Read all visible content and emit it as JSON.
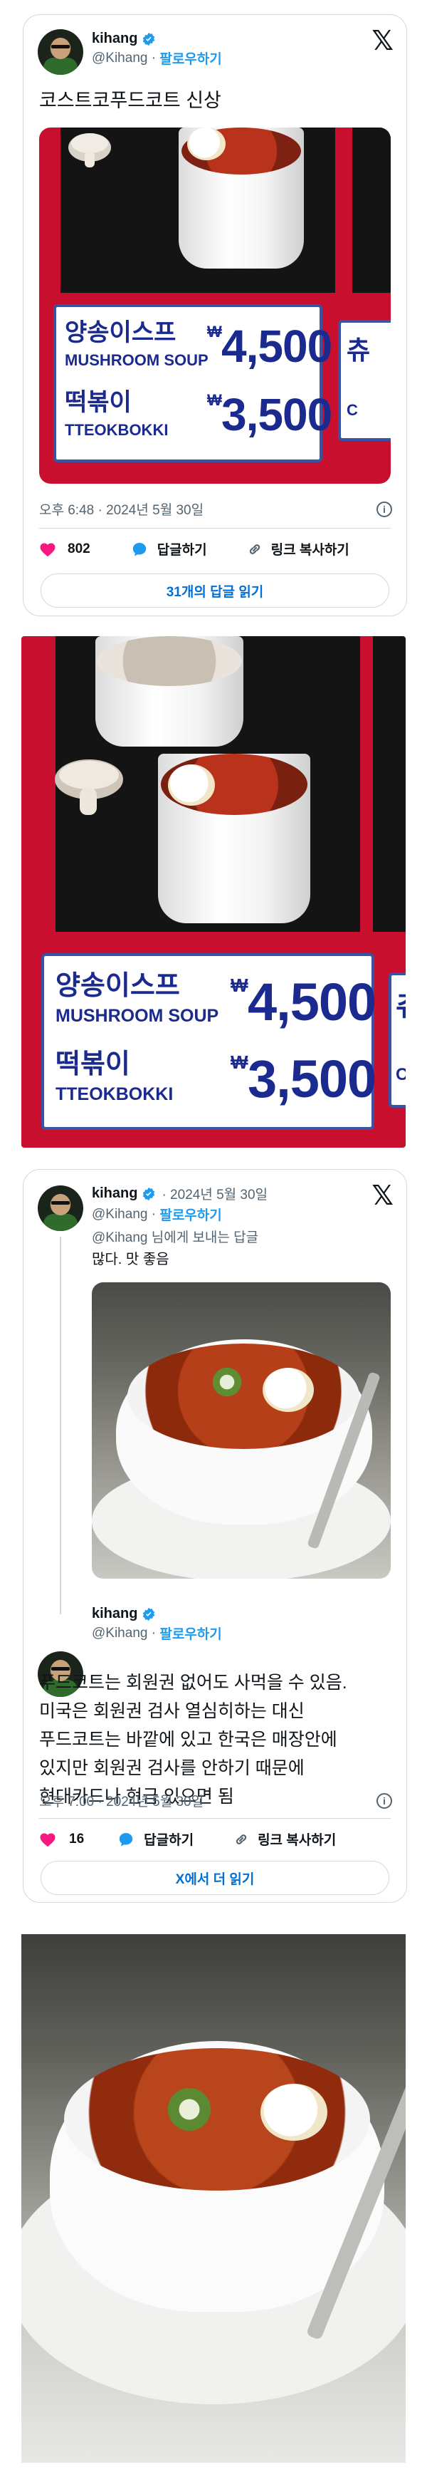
{
  "tweet1": {
    "display_name": "kihang",
    "handle": "@Kihang",
    "follow_label": "팔로우하기",
    "x_logo": "𝕏",
    "text": "코스트코푸드코트 신상",
    "timestamp": "오후 6:48 · 2024년 5월 30일",
    "info": "i",
    "likes": "802",
    "reply_label": "답글하기",
    "copy_link_label": "링크 복사하기",
    "read_replies": "31개의 답글 읽기"
  },
  "menu_board": {
    "item1_ko": "양송이스프",
    "item1_en": "MUSHROOM SOUP",
    "item1_price": "4,500",
    "item2_ko": "떡볶이",
    "item2_en": "TTEOKBOKKI",
    "item2_price": "3,500",
    "currency": "₩",
    "partial_ko": "츄",
    "partial_en": "C"
  },
  "tweet2": {
    "display_name": "kihang",
    "date_inline": "· 2024년 5월 30일",
    "handle": "@Kihang",
    "follow_label": "팔로우하기",
    "x_logo": "𝕏",
    "reply_context": "@Kihang 님에게 보내는 답글",
    "text": "많다. 맛 좋음"
  },
  "tweet3": {
    "display_name": "kihang",
    "handle": "@Kihang",
    "follow_label": "팔로우하기",
    "text": "푸드코트는 회원권 없어도 사먹을 수 있음. 미국은 회원권 검사 열심히하는 대신 푸드코트는 바깥에 있고 한국은 매장안에 있지만 회원권 검사를 안하기 때문에 현대카드나 현금 있으면 됨",
    "timestamp": "오후 7:00 · 2024년 5월 30일",
    "info": "i",
    "likes": "16",
    "reply_label": "답글하기",
    "copy_link_label": "링크 복사하기",
    "read_more": "X에서 더 읽기"
  },
  "colors": {
    "accent": "#1d9bf0",
    "heart": "#f91880",
    "link_blue": "#006fd6",
    "board_red": "#c8102e",
    "sign_blue": "#1b2a8f"
  }
}
